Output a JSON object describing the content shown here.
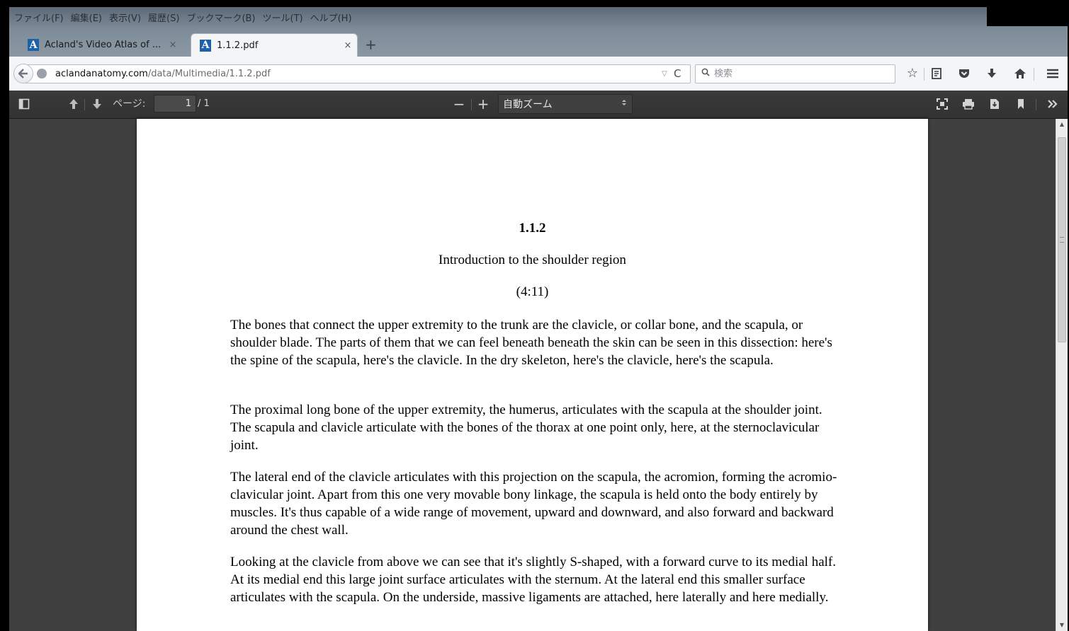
{
  "menu": [
    "ファイル(F)",
    "編集(E)",
    "表示(V)",
    "履歴(S)",
    "ブックマーク(B)",
    "ツール(T)",
    "ヘルプ(H)"
  ],
  "tabs": [
    {
      "label": "Acland's Video Atlas of ...",
      "favicon": "A",
      "close": "×"
    },
    {
      "label": "1.1.2.pdf",
      "favicon": "A",
      "close": "×"
    }
  ],
  "new_tab": "+",
  "nav": {
    "back_icon": "arrow-left",
    "url_host": "aclandanatomy.com",
    "url_path": "/data/Multimedia/1.1.2.pdf",
    "url_dropdown": "▽",
    "reload": "C",
    "search_icon": "🔍",
    "search_placeholder": "検索",
    "icons": [
      "star-icon",
      "reading-list-icon",
      "pocket-icon",
      "download-icon",
      "home-icon",
      "menu-icon"
    ]
  },
  "pdf_toolbar": {
    "sidebar_icon": "◫",
    "prev_icon": "🡅",
    "next_icon": "🡇",
    "page_label": "ページ:",
    "page_value": "1",
    "page_total": "/ 1",
    "zoom_out": "−",
    "zoom_in": "+",
    "zoom_value": "自動ズーム",
    "zoom_arrow": "◆",
    "right_icons": [
      "fullscreen-icon",
      "print-icon",
      "save-icon",
      "bookmark-icon",
      "tools-icon"
    ]
  },
  "document": {
    "number": "1.1.2",
    "title": "Introduction to the shoulder region",
    "duration": "(4:11)",
    "paragraphs": [
      "The bones that connect the upper extremity to the trunk are the clavicle, or collar bone, and the scapula, or shoulder blade. The parts of them that we can feel beneath beneath the skin can be seen in this dissection: here's the spine of the scapula, here's the clavicle. In the dry skeleton, here's the clavicle, here's the scapula.",
      "The proximal long bone of the upper extremity, the humerus, articulates with the scapula at the shoulder joint. The scapula and clavicle articulate with the bones of the thorax at one point only, here, at the sternoclavicular joint.",
      "The lateral end of the clavicle articulates with this projection on the scapula, the acromion, forming the acromio-clavicular joint. Apart from this one very movable bony linkage, the scapula is held onto the body entirely by muscles. It's thus capable of a wide range of movement, upward and downward, and also forward and backward around the chest wall.",
      "Looking at the clavicle from above we can see that it's slightly S-shaped, with a forward curve to its medial half. At its medial end this large joint surface articulates with the sternum. At the lateral end this smaller surface articulates with the scapula. On the underside, massive ligaments are attached, here laterally and here medially."
    ]
  },
  "colors": {
    "favicon": "#1d62a8",
    "pdf_toolbar": "#3a3a3a",
    "viewer_bg": "#404040"
  }
}
